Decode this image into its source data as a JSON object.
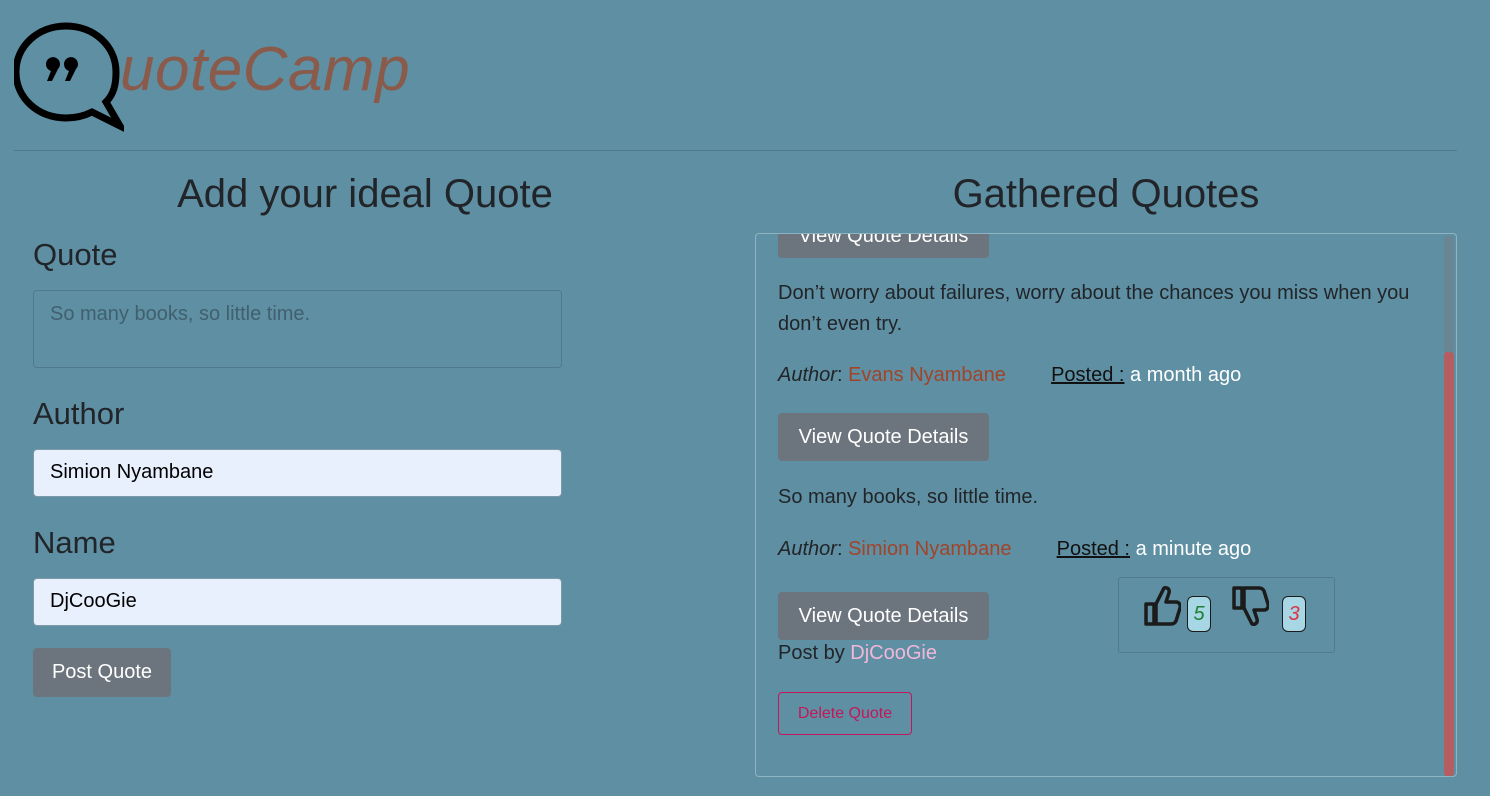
{
  "header": {
    "logo_text": "uoteCamp"
  },
  "form": {
    "title": "Add your ideal Quote",
    "quote_label": "Quote",
    "quote_placeholder": "So many books, so little time.",
    "author_label": "Author",
    "author_value": "Simion Nyambane",
    "name_label": "Name",
    "name_value": "DjCooGie",
    "submit_label": "Post Quote"
  },
  "quotes": {
    "title": "Gathered Quotes",
    "partial_button_label": "View Quote Details",
    "items": [
      {
        "text": "Don’t worry about failures, worry about the chances you miss when you don’t even try.",
        "author_label": "Author",
        "author": "Evans Nyambane",
        "posted_label": "Posted :",
        "posted_time": "a month ago",
        "button_label": "View Quote Details"
      },
      {
        "text": "So many books, so little time.",
        "author_label": "Author",
        "author": "Simion Nyambane",
        "posted_label": "Posted :",
        "posted_time": "a minute ago",
        "button_label": "View Quote Details",
        "post_by_label": "Post by",
        "post_by": "DjCooGie",
        "delete_label": "Delete Quote",
        "upvotes": "5",
        "downvotes": "3"
      }
    ]
  },
  "colors": {
    "background": "#5f8fa2",
    "brand": "#8a5a4b",
    "author": "#a0442a",
    "upvote": "#1e7e34",
    "downvote": "#dc3545",
    "delete": "#c2185b"
  },
  "icons": [
    "speech-bubble-quote-icon",
    "thumbs-up-icon",
    "thumbs-down-icon"
  ]
}
